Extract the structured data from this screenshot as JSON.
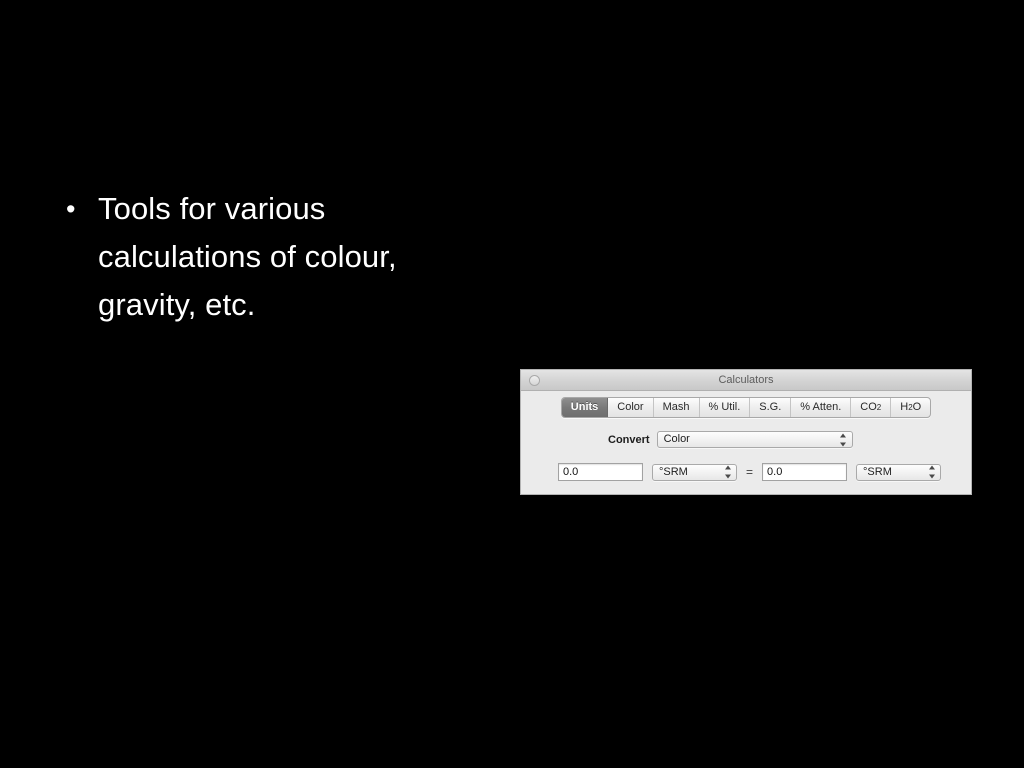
{
  "slide": {
    "bullet_marker": "•",
    "bullet_text": "Tools for various\ncalculations of colour,\ngravity, etc.",
    "background_color": "#000000",
    "text_color": "#ffffff"
  },
  "window": {
    "title": "Calculators",
    "close_button": "close-button",
    "tabs": [
      {
        "label": "Units",
        "selected": true
      },
      {
        "label": "Color",
        "selected": false
      },
      {
        "label": "Mash",
        "selected": false
      },
      {
        "label": "% Util.",
        "selected": false
      },
      {
        "label": "S.G.",
        "selected": false
      },
      {
        "label": "% Atten.",
        "selected": false
      },
      {
        "label": "CO2",
        "label_main": "CO",
        "label_sub": "2",
        "selected": false
      },
      {
        "label": "H2O",
        "label_main": "H",
        "label_sub": "2",
        "label_tail": "O",
        "selected": false
      }
    ],
    "convert": {
      "label": "Convert",
      "selected_option": "Color"
    },
    "conversion": {
      "left_value": "0.0",
      "left_unit": "°SRM",
      "equals": "=",
      "right_value": "0.0",
      "right_unit": "°SRM"
    },
    "colors": {
      "chrome": "#ebebeb",
      "titlebar": "#d3d3d3",
      "selected_tab": "#797979",
      "field": "#ffffff"
    }
  }
}
